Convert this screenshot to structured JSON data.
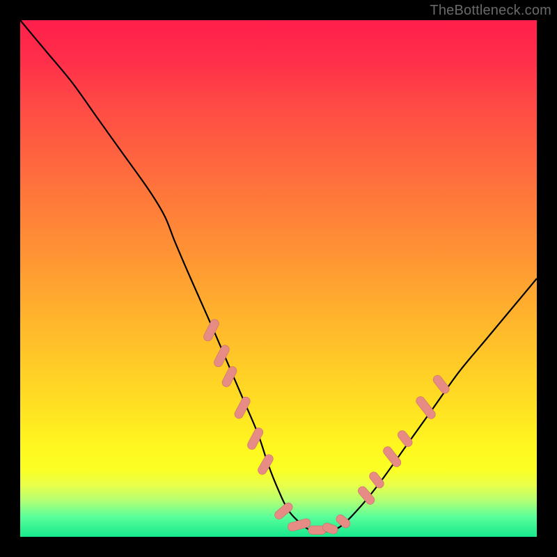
{
  "watermark": "TheBottleneck.com",
  "colors": {
    "frame": "#000000",
    "curve": "#000000",
    "marker_fill": "#e78b85",
    "marker_stroke": "#c96e6c"
  },
  "chart_data": {
    "type": "line",
    "title": "",
    "xlabel": "",
    "ylabel": "",
    "xlim": [
      0,
      100
    ],
    "ylim": [
      0,
      100
    ],
    "grid": false,
    "legend": false,
    "series": [
      {
        "name": "bottleneck-curve",
        "x": [
          0,
          5,
          10,
          15,
          20,
          25,
          28,
          30,
          33,
          37,
          40,
          43,
          46,
          48,
          50,
          52,
          55,
          57,
          59,
          62,
          66,
          70,
          75,
          80,
          85,
          90,
          95,
          100
        ],
        "y": [
          100,
          94,
          88,
          81,
          74,
          67,
          62,
          57,
          50,
          41,
          34,
          27,
          20,
          14,
          9,
          5,
          2,
          1,
          1,
          2,
          6,
          11,
          18,
          25,
          32,
          38,
          44,
          50
        ]
      }
    ],
    "markers": {
      "left_cluster": [
        {
          "x": 37,
          "y": 40,
          "len": 4.5,
          "angle": -63
        },
        {
          "x": 39,
          "y": 35,
          "len": 4.5,
          "angle": -63
        },
        {
          "x": 40.5,
          "y": 31,
          "len": 4.2,
          "angle": -63
        },
        {
          "x": 43,
          "y": 25,
          "len": 4.5,
          "angle": -62
        },
        {
          "x": 45.5,
          "y": 19,
          "len": 4.5,
          "angle": -62
        },
        {
          "x": 47.5,
          "y": 14,
          "len": 4.2,
          "angle": -60
        }
      ],
      "bottom_cluster": [
        {
          "x": 51,
          "y": 5,
          "len": 4.0,
          "angle": -40
        },
        {
          "x": 54,
          "y": 2.3,
          "len": 4.5,
          "angle": -15
        },
        {
          "x": 57.5,
          "y": 1.3,
          "len": 3.5,
          "angle": 0
        },
        {
          "x": 60,
          "y": 1.6,
          "len": 3.0,
          "angle": 20
        },
        {
          "x": 62.5,
          "y": 3,
          "len": 3.0,
          "angle": 40
        }
      ],
      "right_cluster": [
        {
          "x": 67,
          "y": 8,
          "len": 4.0,
          "angle": 50
        },
        {
          "x": 69,
          "y": 11,
          "len": 3.5,
          "angle": 52
        },
        {
          "x": 72,
          "y": 15.5,
          "len": 4.5,
          "angle": 52
        },
        {
          "x": 74.5,
          "y": 19,
          "len": 3.5,
          "angle": 52
        },
        {
          "x": 78.5,
          "y": 25,
          "len": 5.0,
          "angle": 52
        },
        {
          "x": 81.5,
          "y": 29.5,
          "len": 4.0,
          "angle": 52
        }
      ]
    }
  }
}
